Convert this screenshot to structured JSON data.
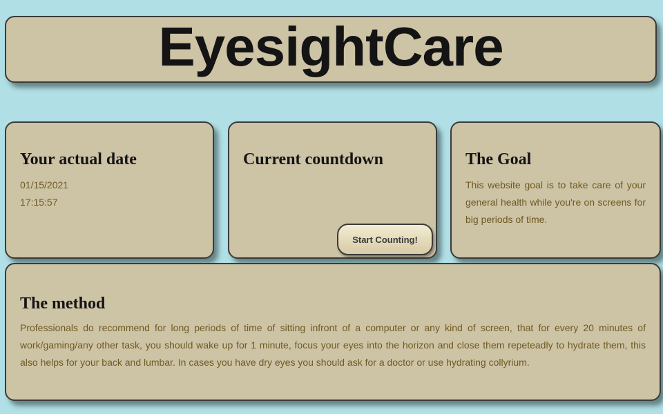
{
  "header": {
    "title": "EyesightCare"
  },
  "date_card": {
    "heading": "Your actual date",
    "date": "01/15/2021",
    "time": "17:15:57"
  },
  "countdown_card": {
    "heading": "Current countdown",
    "start_button": "Start Counting!"
  },
  "goal_card": {
    "heading": "The Goal",
    "body": "This website goal is to take care of your general health while you're on screens for big periods of time."
  },
  "method_card": {
    "heading": "The method",
    "body": "Professionals do recommend for long periods of time of sitting infront of a computer or any kind of screen, that for every 20 minutes of work/gaming/any other task, you should wake up for 1 minute, focus your eyes into the horizon and close them repeteadly to hydrate them, this also helps for your back and lumbar. In cases you have dry eyes you should ask for a doctor or use hydrating collyrium."
  },
  "colors": {
    "page_background": "#b0dfe5",
    "card_background": "#cdc3a5",
    "body_text": "#6e5a22",
    "heading_text": "#141414"
  }
}
